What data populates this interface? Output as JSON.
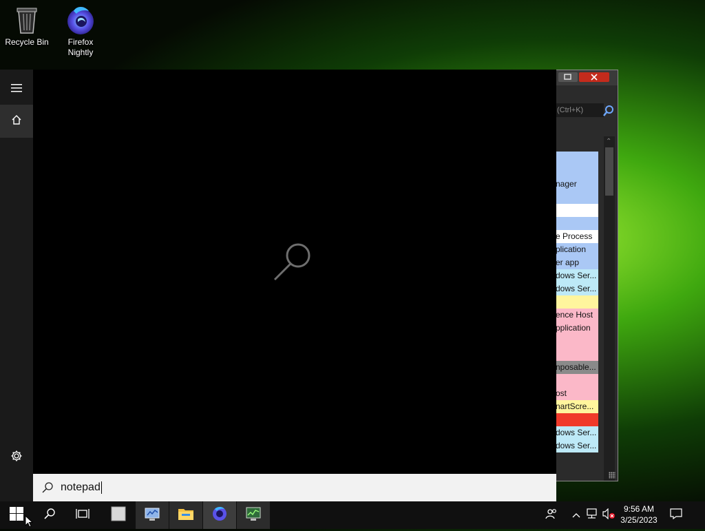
{
  "desktop": {
    "icons": [
      {
        "label": "Recycle Bin",
        "icon": "recycle-bin-icon"
      },
      {
        "label": "Firefox Nightly",
        "icon": "firefox-nightly-icon"
      }
    ]
  },
  "background_window": {
    "search_placeholder": "(Ctrl+K)",
    "rows": [
      {
        "text": "",
        "color": "#aac8f5"
      },
      {
        "text": "",
        "color": "#aac8f5"
      },
      {
        "text": "nager",
        "color": "#aac8f5"
      },
      {
        "text": "",
        "color": "#aac8f5"
      },
      {
        "text": "",
        "color": "#ffffff"
      },
      {
        "text": "",
        "color": "#aac8f5"
      },
      {
        "text": "e Process",
        "color": "#ffffff"
      },
      {
        "text": "plication",
        "color": "#aac8f5"
      },
      {
        "text": "er app",
        "color": "#aac8f5"
      },
      {
        "text": "dows Ser...",
        "color": "#bde9f7"
      },
      {
        "text": "dows Ser...",
        "color": "#bde9f7"
      },
      {
        "text": "",
        "color": "#fff59d"
      },
      {
        "text": "ence Host",
        "color": "#fbb8c8"
      },
      {
        "text": "pplication",
        "color": "#fbb8c8"
      },
      {
        "text": "",
        "color": "#fbb8c8"
      },
      {
        "text": "",
        "color": "#fbb8c8"
      },
      {
        "text": "nposable...",
        "color": "#8a8a8a"
      },
      {
        "text": "",
        "color": "#fbb8c8"
      },
      {
        "text": "ost",
        "color": "#fbb8c8"
      },
      {
        "text": "nartScre...",
        "color": "#fff59d"
      },
      {
        "text": "",
        "color": "#f03a2a"
      },
      {
        "text": "dows Ser...",
        "color": "#bde9f7"
      },
      {
        "text": "dows Ser...",
        "color": "#bde9f7"
      }
    ]
  },
  "start_panel": {
    "rail": [
      "hamburger-menu-icon",
      "home-icon",
      "settings-icon"
    ],
    "center_icon": "search-magnifier-icon"
  },
  "search": {
    "value": "notepad"
  },
  "taskbar": {
    "apps": [
      "task-manager-app",
      "file-explorer-app",
      "firefox-nightly-app",
      "performance-monitor-app"
    ],
    "clock": {
      "time": "9:56 AM",
      "date": "3/25/2023"
    }
  }
}
